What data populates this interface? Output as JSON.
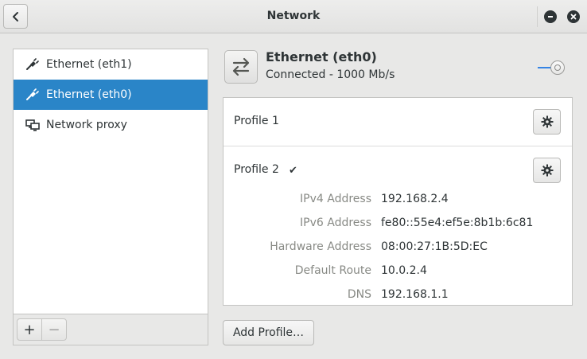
{
  "window": {
    "title": "Network",
    "back_icon": "chevron-left-icon",
    "minimize_icon": "minimize-icon",
    "close_icon": "close-icon"
  },
  "sidebar": {
    "items": [
      {
        "label": "Ethernet (eth1)",
        "icon": "ethernet-plug-icon",
        "selected": false
      },
      {
        "label": "Ethernet (eth0)",
        "icon": "ethernet-plug-icon",
        "selected": true
      },
      {
        "label": "Network proxy",
        "icon": "network-proxy-icon",
        "selected": false
      }
    ],
    "toolbar": {
      "add_label": "+",
      "remove_label": "−"
    }
  },
  "device": {
    "name": "Ethernet (eth0)",
    "status": "Connected - 1000 Mb/s",
    "icon": "network-transfer-icon",
    "switch_on": true
  },
  "profiles": [
    {
      "name": "Profile 1",
      "active": false
    },
    {
      "name": "Profile 2",
      "active": true
    }
  ],
  "details": [
    {
      "key": "IPv4 Address",
      "value": "192.168.2.4"
    },
    {
      "key": "IPv6 Address",
      "value": "fe80::55e4:ef5e:8b1b:6c81"
    },
    {
      "key": "Hardware Address",
      "value": "08:00:27:1B:5D:EC"
    },
    {
      "key": "Default Route",
      "value": "10.0.2.4"
    },
    {
      "key": "DNS",
      "value": "192.168.1.1"
    }
  ],
  "add_profile_label": "Add Profile…",
  "colors": {
    "accent": "#2a85c8",
    "switch_accent": "#3584e4"
  }
}
